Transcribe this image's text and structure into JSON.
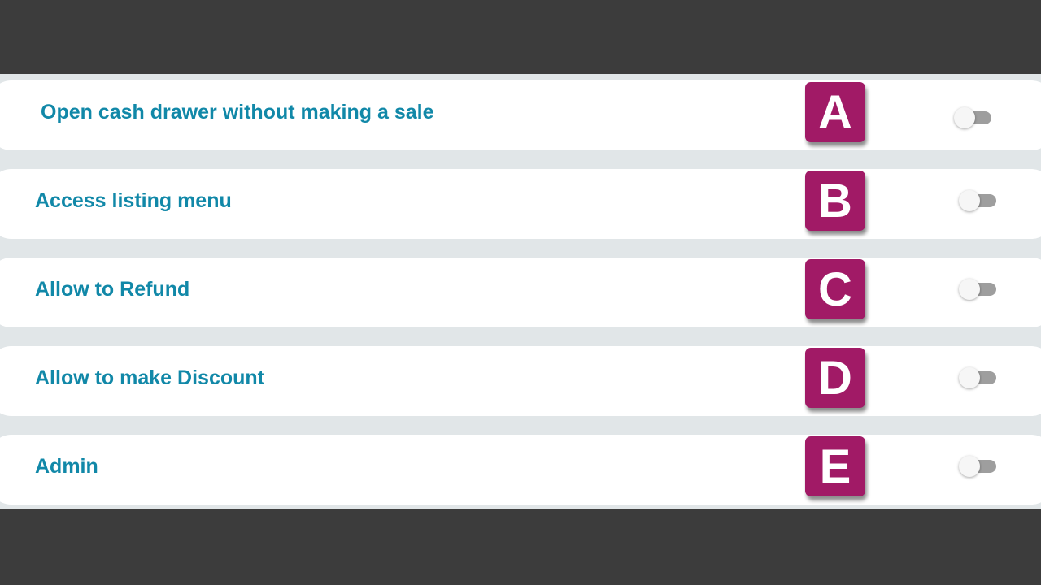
{
  "permissions": [
    {
      "label": "Open cash drawer without making a sale",
      "badge": "A",
      "enabled": false
    },
    {
      "label": "Access listing menu",
      "badge": "B",
      "enabled": false
    },
    {
      "label": "Allow to Refund",
      "badge": "C",
      "enabled": false
    },
    {
      "label": "Allow to make Discount",
      "badge": "D",
      "enabled": false
    },
    {
      "label": "Admin",
      "badge": "E",
      "enabled": false
    }
  ],
  "colors": {
    "label_text": "#1188a8",
    "badge_background": "#a11a66",
    "switch_track_off": "#9e9e9e",
    "switch_thumb": "#f6f6f6",
    "row_background": "#ffffff",
    "panel_background": "#e1e6e8",
    "page_background": "#3c3c3c"
  }
}
